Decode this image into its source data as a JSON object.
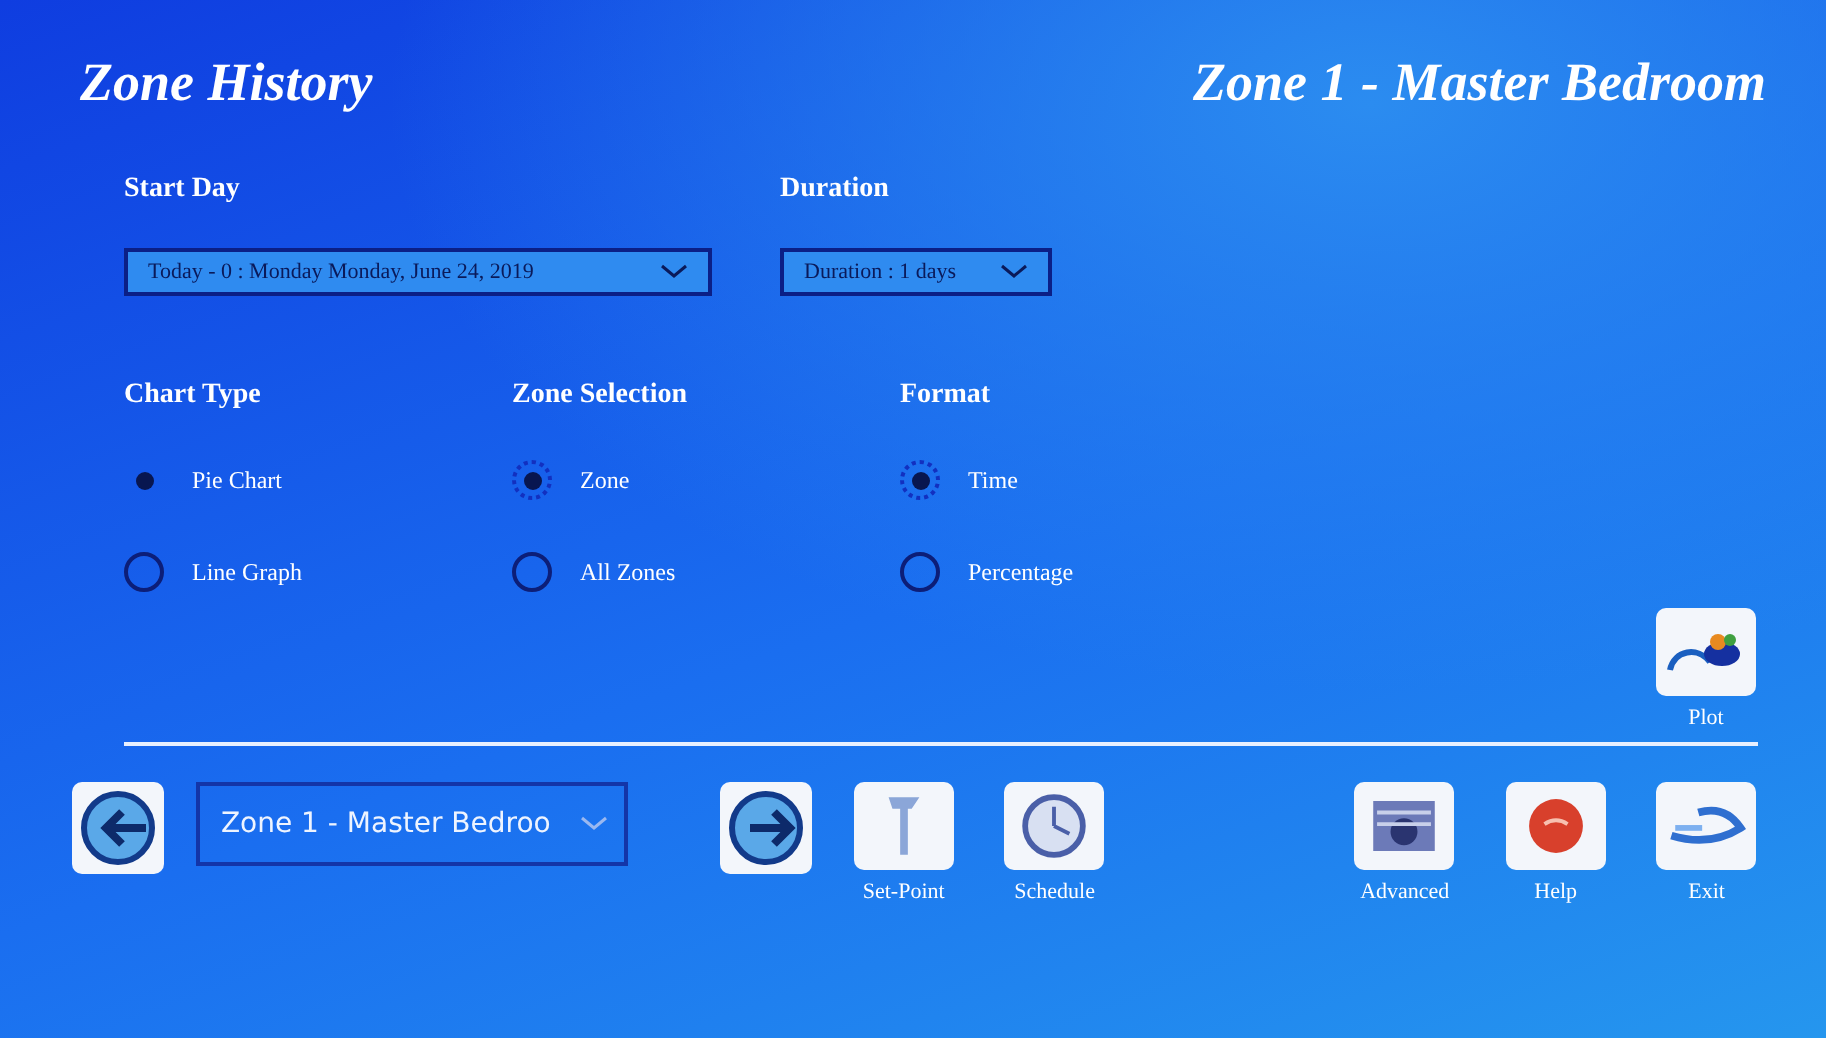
{
  "header": {
    "title": "Zone History",
    "zone_name": "Zone 1 - Master Bedroom"
  },
  "start_day": {
    "label": "Start Day",
    "value": "Today - 0 : Monday Monday, June 24, 2019"
  },
  "duration": {
    "label": "Duration",
    "value": "Duration : 1 days"
  },
  "radio_groups": [
    {
      "label": "Chart Type",
      "options": [
        {
          "label": "Pie Chart",
          "selected": true
        },
        {
          "label": "Line Graph",
          "selected": false
        }
      ]
    },
    {
      "label": "Zone Selection",
      "options": [
        {
          "label": "Zone",
          "selected": true
        },
        {
          "label": "All Zones",
          "selected": false
        }
      ]
    },
    {
      "label": "Format",
      "options": [
        {
          "label": "Time",
          "selected": true
        },
        {
          "label": "Percentage",
          "selected": false
        }
      ]
    }
  ],
  "plot_button": {
    "label": "Plot"
  },
  "zone_selector": {
    "value": "Zone 1 - Master Bedroo"
  },
  "toolbar": [
    {
      "kind": "setpoint",
      "label": "Set-Point"
    },
    {
      "kind": "schedule",
      "label": "Schedule"
    },
    {
      "kind": "spacer"
    },
    {
      "kind": "advanced",
      "label": "Advanced"
    },
    {
      "kind": "help",
      "label": "Help"
    },
    {
      "kind": "exit",
      "label": "Exit"
    }
  ]
}
